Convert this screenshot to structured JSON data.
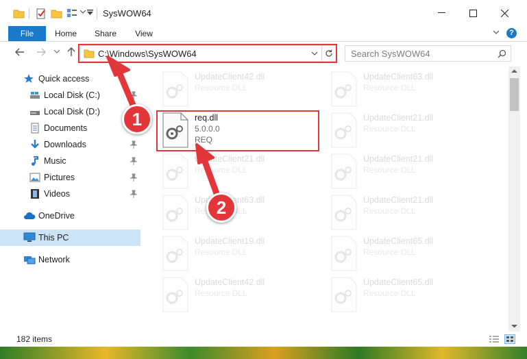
{
  "window": {
    "title": "SysWOW64"
  },
  "ribbon": {
    "tabs": [
      "File",
      "Home",
      "Share",
      "View"
    ]
  },
  "address": {
    "path": "C:\\Windows\\SysWOW64",
    "search_placeholder": "Search SysWOW64"
  },
  "sidebar": {
    "items": [
      {
        "label": "Quick access",
        "icon": "star-icon"
      },
      {
        "label": "Local Disk (C:)",
        "icon": "drive-icon",
        "pinned": true
      },
      {
        "label": "Local Disk (D:)",
        "icon": "drive-icon"
      },
      {
        "label": "Documents",
        "icon": "documents-icon",
        "pinned": true
      },
      {
        "label": "Downloads",
        "icon": "download-icon",
        "pinned": true
      },
      {
        "label": "Music",
        "icon": "music-icon",
        "pinned": true
      },
      {
        "label": "Pictures",
        "icon": "pictures-icon",
        "pinned": true
      },
      {
        "label": "Videos",
        "icon": "video-icon",
        "pinned": true
      },
      {
        "label": "OneDrive",
        "icon": "cloud-icon"
      },
      {
        "label": "This PC",
        "icon": "computer-icon",
        "selected": true
      },
      {
        "label": "Network",
        "icon": "network-icon"
      }
    ]
  },
  "files": [
    {
      "name": "UpdateClient42.dll",
      "sub1": "Resource DLL",
      "sub2": ""
    },
    {
      "name": "UpdateClient63.dll",
      "sub1": "Resource DLL",
      "sub2": ""
    },
    {
      "name": "req.dll",
      "sub1": "5.0.0.0",
      "sub2": "REQ",
      "highlighted": true
    },
    {
      "name": "UpdateClient21.dll",
      "sub1": "Resource DLL",
      "sub2": ""
    },
    {
      "name": "UpdateClient21.dll",
      "sub1": "Resource DLL",
      "sub2": ""
    },
    {
      "name": "UpdateClient21.dll",
      "sub1": "Resource DLL",
      "sub2": ""
    },
    {
      "name": "UpdateClient63.dll",
      "sub1": "Resource DLL",
      "sub2": ""
    },
    {
      "name": "UpdateClient21.dll",
      "sub1": "Resource DLL",
      "sub2": ""
    },
    {
      "name": "UpdateClient19.dll",
      "sub1": "Resource DLL",
      "sub2": ""
    },
    {
      "name": "UpdateClient65.dll",
      "sub1": "Resource DLL",
      "sub2": ""
    },
    {
      "name": "UpdateClient42.dll",
      "sub1": "Resource DLL",
      "sub2": ""
    },
    {
      "name": "UpdateClient65.dll",
      "sub1": "Resource DLL",
      "sub2": ""
    }
  ],
  "status": {
    "count": "182 items"
  },
  "annotations": {
    "step1": "1",
    "step2": "2",
    "color": "#e3363b"
  },
  "colors": {
    "accent": "#1979ca",
    "selected_bg": "#cde4f7"
  }
}
